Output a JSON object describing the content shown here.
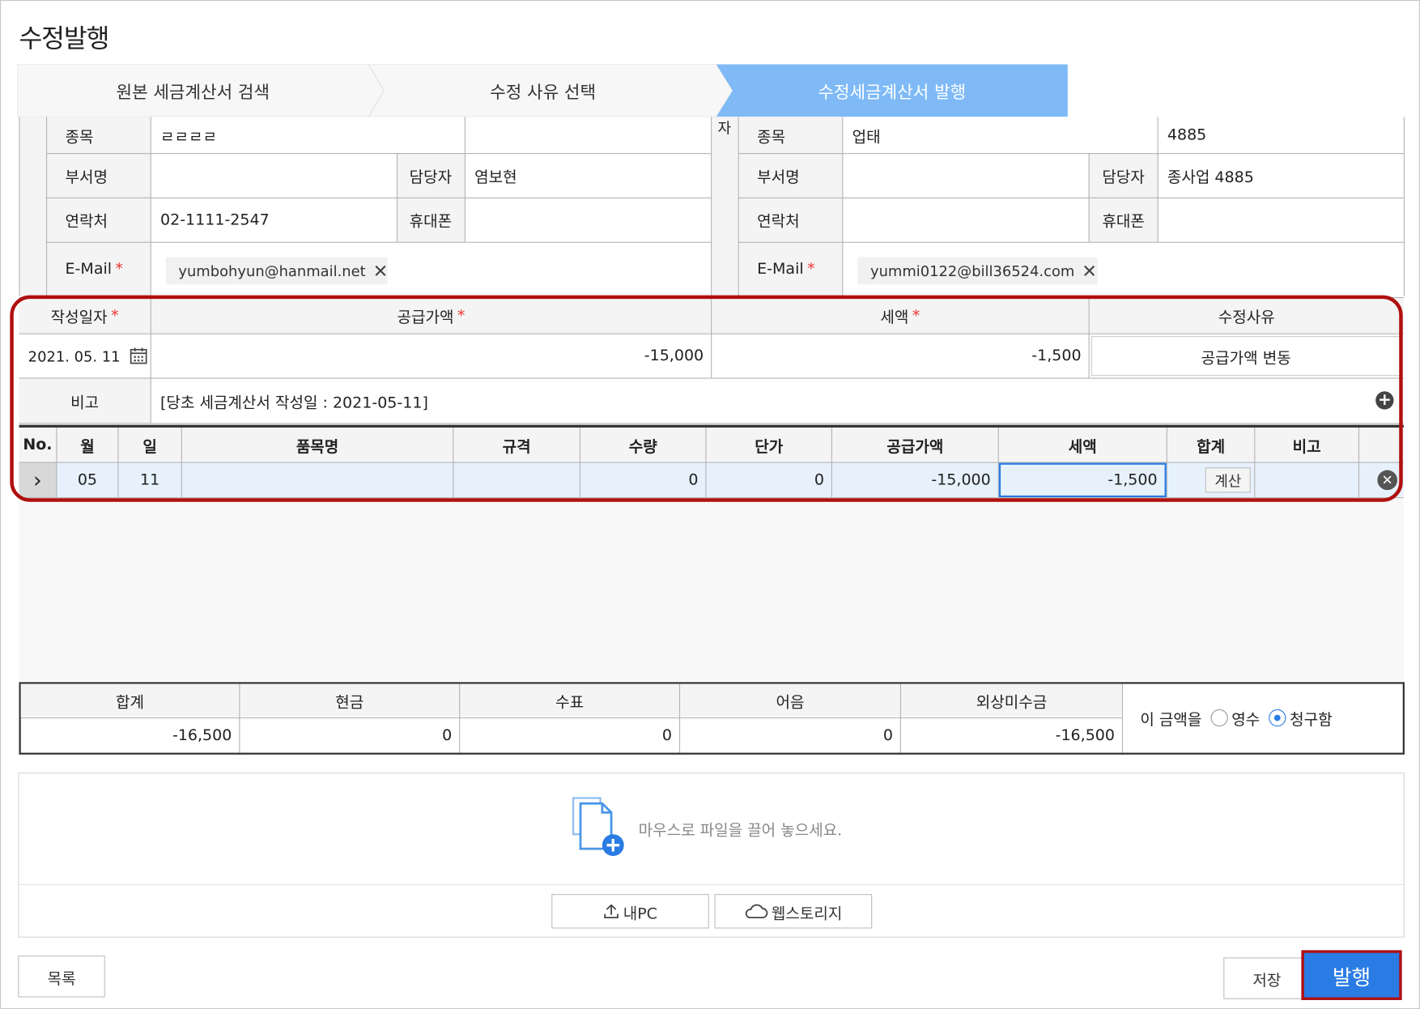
{
  "page": {
    "title": "수정발행"
  },
  "steps": [
    {
      "label": "원본 세금계산서 검색"
    },
    {
      "label": "수정 사유 선택"
    },
    {
      "label": "수정세금계산서 발행"
    }
  ],
  "supplier": {
    "jongmok_label": "종목",
    "jongmok_value": "ㄹㄹㄹㄹ",
    "dept_label": "부서명",
    "dept_value": "",
    "manager_label": "담당자",
    "manager_value": "염보현",
    "contact_label": "연락처",
    "contact_value": "02-1111-2547",
    "mobile_label": "휴대폰",
    "mobile_value": "",
    "email_label": "E-Mail",
    "email_value": "yumbohyun@hanmail.net"
  },
  "buyer": {
    "side_char": "자",
    "jongmok_label": "종목",
    "jongmok_value": "업태",
    "extra_value": "4885",
    "dept_label": "부서명",
    "dept_value": "",
    "manager_label": "담당자",
    "manager_value": "종사업 4885",
    "contact_label": "연락처",
    "contact_value": "",
    "mobile_label": "휴대폰",
    "mobile_value": "",
    "email_label": "E-Mail",
    "email_value": "yummi0122@bill36524.com"
  },
  "summary": {
    "date_label": "작성일자",
    "date_value": "2021. 05. 11",
    "supply_label": "공급가액",
    "supply_value": "-15,000",
    "tax_label": "세액",
    "tax_value": "-1,500",
    "reason_label": "수정사유",
    "reason_value": "공급가액 변동",
    "note_label": "비고",
    "note_value": "[당초 세금계산서 작성일 : 2021-05-11]",
    "required_mark": "*"
  },
  "items": {
    "headers": [
      "No.",
      "월",
      "일",
      "품목명",
      "규격",
      "수량",
      "단가",
      "공급가액",
      "세액",
      "합계",
      "비고"
    ],
    "row": {
      "arrow": "›",
      "month": "05",
      "day": "11",
      "name": "",
      "spec": "",
      "qty": "0",
      "price": "0",
      "supply": "-15,000",
      "tax": "-1,500",
      "calc_label": "계산",
      "note": ""
    }
  },
  "totals": {
    "headers": [
      "합계",
      "현금",
      "수표",
      "어음",
      "외상미수금"
    ],
    "values": [
      "-16,500",
      "0",
      "0",
      "0",
      "-16,500"
    ],
    "amount_label": "이 금액을",
    "receipt_label": "영수",
    "claim_label": "청구함",
    "selected": "청구함"
  },
  "attach": {
    "drop_text": "마우스로 파일을 끌어 놓으세요.",
    "mypc_label": "내PC",
    "webstorage_label": "웹스토리지"
  },
  "footer": {
    "list_label": "목록",
    "save_label": "저장",
    "issue_label": "발행"
  },
  "colors": {
    "accent": "#2a7be4",
    "active_step": "#7fbaf7",
    "highlight": "#b00f0f",
    "selected_row": "#e6f1fc"
  }
}
